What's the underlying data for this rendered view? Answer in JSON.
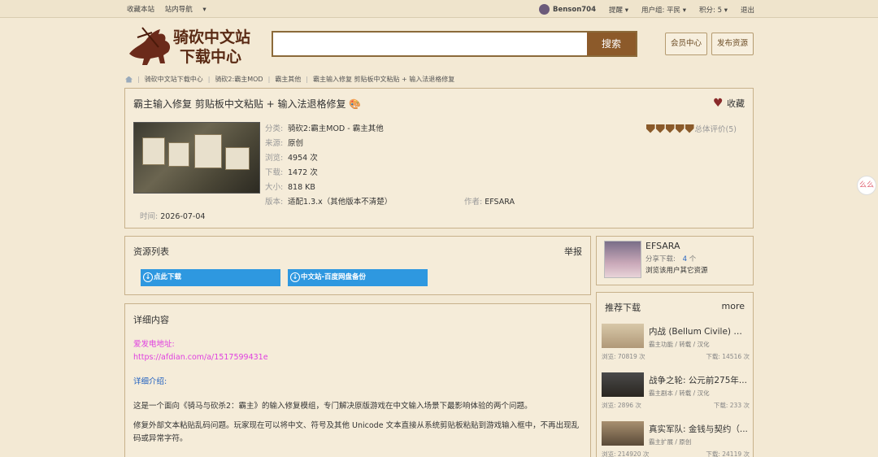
{
  "topbar": {
    "left": [
      "收藏本站",
      "站内导航"
    ],
    "user": "Benson704",
    "remind": "提醒",
    "group": "用户组: 平民",
    "points": "积分: 5",
    "logout": "退出"
  },
  "header": {
    "logo_text_1": "骑砍中文站",
    "logo_text_2": "下载中心",
    "search_placeholder": "",
    "search_button": "搜索",
    "member_center": "会员中心",
    "publish": "发布资源"
  },
  "breadcrumb": [
    "骑砍中文站下载中心",
    "骑砍2:霸主MOD",
    "霸主其他",
    "霸主输入修复 剪贴板中文粘贴 + 输入法退格修复"
  ],
  "resource": {
    "title": "霸主输入修复 剪贴板中文粘贴 + 输入法退格修复",
    "favorite": "收藏",
    "labels": {
      "category": "分类:",
      "source": "来源:",
      "views": "浏览:",
      "downloads": "下载:",
      "size": "大小:",
      "version": "版本:",
      "author": "作者:",
      "time": "时间:"
    },
    "category": "骑砍2:霸主MOD - 霸主其他",
    "source": "原创",
    "views": "4954 次",
    "downloads": "1472 次",
    "size": "818 KB",
    "version": "适配1.3.x（其他版本不清楚）",
    "author": "EFSARA",
    "time": "2026-07-04",
    "rating_text": "总体评价(5)"
  },
  "resources_list": {
    "title": "资源列表",
    "report": "举报",
    "buttons": [
      "点此下载",
      "中文站-百度网盘备份"
    ]
  },
  "details": {
    "title": "详细内容",
    "afdian_label": "爱发电地址:",
    "afdian_url": "https://afdian.com/a/1517599431e",
    "intro_label": "详细介绍:",
    "para1": "这是一个面向《骑马与砍杀2：霸主》的输入修复模组，专门解决原版游戏在中文输入场景下最影响体验的两个问题。",
    "para2": "修复外部文本粘贴乱码问题。玩家现在可以将中文、符号及其他 Unicode 文本直接从系统剪贴板粘贴到游戏输入框中，不再出现乱码或异常字符。"
  },
  "uploader": {
    "name": "EFSARA",
    "share_label": "分享下载:",
    "share_count": "4",
    "share_unit": "个",
    "browse": "浏览该用户其它资源"
  },
  "recommended": {
    "title": "推荐下载",
    "more": "more",
    "items": [
      {
        "title": "内战 (Bellum Civile) 简...",
        "sub": "霸主功能 / 转载 / 汉化",
        "views": "浏览: 70819 次",
        "downloads": "下载: 14516 次"
      },
      {
        "title": "战争之轮: 公元前275年...",
        "sub": "霸主剧本 / 转载 / 汉化",
        "views": "浏览: 2896 次",
        "downloads": "下载: 233 次"
      },
      {
        "title": "真实军队: 金钱与契约（...",
        "sub": "霸主扩展 / 原创",
        "views": "浏览: 214920 次",
        "downloads": "下载: 24119 次"
      }
    ]
  },
  "side_bubble": "么么"
}
